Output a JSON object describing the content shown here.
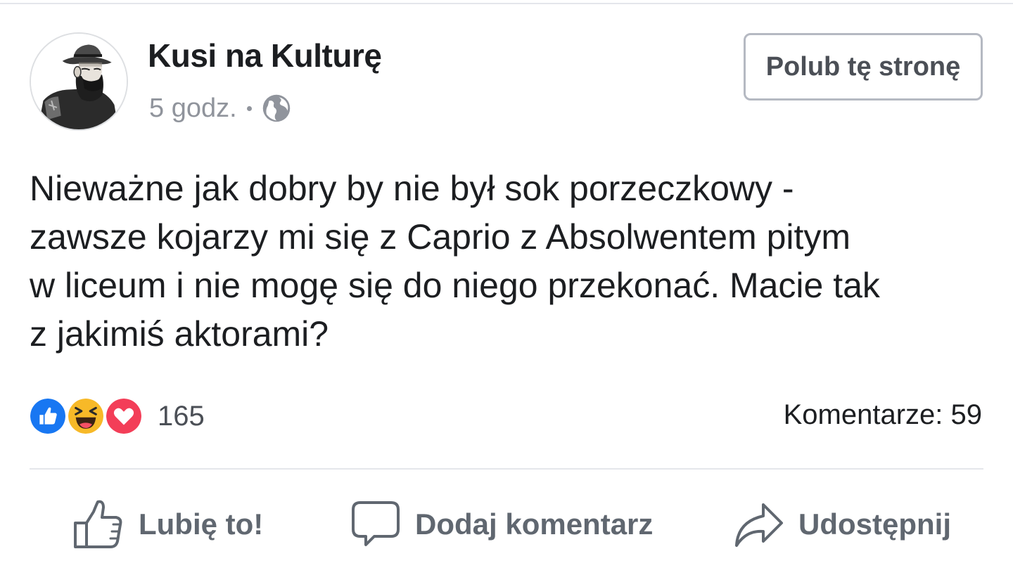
{
  "post": {
    "page_name": "Kusi na Kulturę",
    "time": "5 godz.",
    "visibility_icon": "globe-icon",
    "like_page_button": "Polub tę stronę",
    "text_lines": [
      "Nieważne jak dobry by nie był sok porzeczkowy -",
      "zawsze kojarzy mi się z Caprio z Absolwentem pitym",
      "w liceum i nie mogę się do niego przekonać. Macie tak",
      "z jakimiś aktorami?"
    ]
  },
  "reactions": {
    "icons": [
      "like-icon",
      "haha-icon",
      "love-icon"
    ],
    "count": "165",
    "comments": "Komentarze: 59"
  },
  "actions": {
    "like": "Lubię to!",
    "comment": "Dodaj komentarz",
    "share": "Udostępnij"
  },
  "colors": {
    "like_blue": "#1877f2",
    "haha_yellow": "#f7b928",
    "love_red": "#f33e58",
    "secondary_text": "#90949c",
    "action_text": "#606770"
  }
}
